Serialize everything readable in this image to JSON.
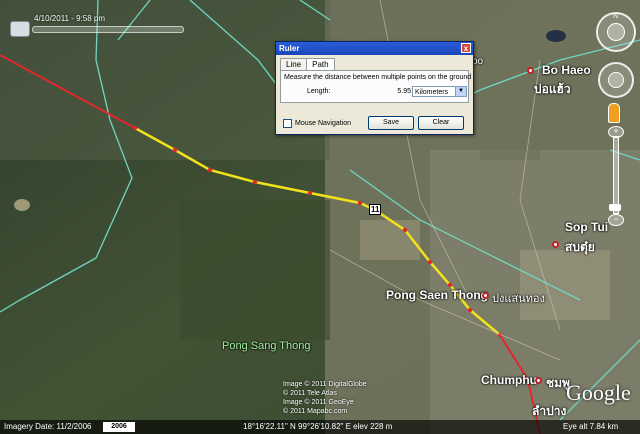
{
  "time_slider": {
    "label": "4/10/2011 - 9:58 pm"
  },
  "ruler": {
    "title": "Ruler",
    "close_label": "x",
    "tabs": [
      {
        "label": "Line"
      },
      {
        "label": "Path"
      }
    ],
    "description": "Measure the distance between multiple points on the ground",
    "length_label": "Length:",
    "length_value": "5.95",
    "unit": "Kilometers",
    "mouse_nav_label": "Mouse Navigation",
    "save_label": "Save",
    "clear_label": "Clear"
  },
  "map_labels": {
    "bo_haeo": "Bo Haeo",
    "bo_haeo_thai": "บ่อแฮ้ว",
    "sop_tui": "Sop Tui",
    "sop_tui_thai": "สบตุ๋ย",
    "pong_saen_thong": "Pong Saen Thong",
    "pong_saen_thong_thai": "ปงแสนทอง",
    "pong_sang_thong": "Pong Sang Thong",
    "chumphu": "Chumphu",
    "chumphu_thai": "ชมพู",
    "lampang_thai": "ลำปาง",
    "route": "11",
    "bo_partial": "bo"
  },
  "credits": [
    "Image © 2011 DigitalGlobe",
    "© 2011 Tele Atlas",
    "Image © 2011 GeoEye",
    "© 2011 Mapabc.com"
  ],
  "logo": "Google",
  "status_bar": {
    "imagery_date": "Imagery Date: 11/2/2006",
    "year": "2006",
    "coords": "18°16'22.11\" N  99°26'10.82\" E  elev  228 m",
    "eye_alt": "Eye alt    7.84 km"
  },
  "colors": {
    "path": "#f2e21a",
    "road": "#e0282c",
    "boundary": "#6fd6c0"
  }
}
